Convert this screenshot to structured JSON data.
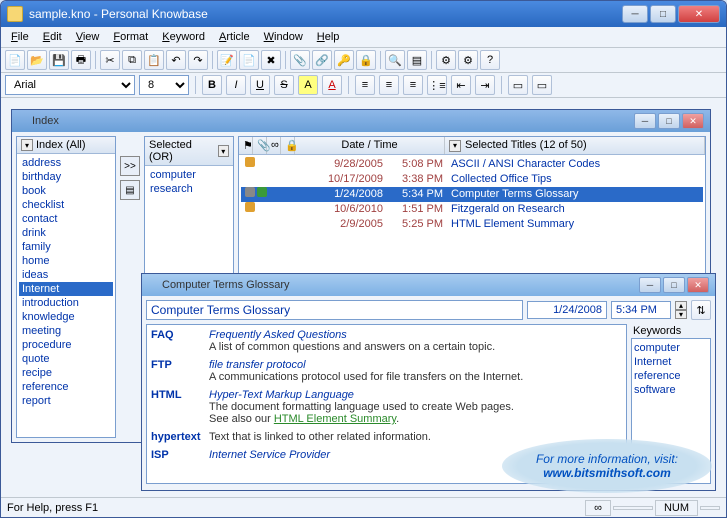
{
  "app": {
    "title": "sample.kno - Personal Knowbase"
  },
  "menu": [
    "File",
    "Edit",
    "View",
    "Format",
    "Keyword",
    "Article",
    "Window",
    "Help"
  ],
  "font": {
    "name": "Arial",
    "size": "8"
  },
  "statusbar": {
    "help": "For Help, press F1",
    "num": "NUM"
  },
  "index": {
    "title": "Index",
    "allLabel": "Index (All)",
    "selectedLabel": "Selected (OR)",
    "items": [
      "address",
      "birthday",
      "book",
      "checklist",
      "contact",
      "drink",
      "family",
      "home",
      "ideas",
      "Internet",
      "introduction",
      "knowledge",
      "meeting",
      "procedure",
      "quote",
      "recipe",
      "reference",
      "report"
    ],
    "selectedIndex": 9,
    "selectedItems": [
      "computer",
      "research"
    ],
    "titlesHeader": {
      "datetime": "Date / Time",
      "titles": "Selected Titles (12 of 50)"
    },
    "rows": [
      {
        "date": "9/28/2005",
        "time": "5:08 PM",
        "name": "ASCII / ANSI Character Codes",
        "icons": [
          "flag"
        ]
      },
      {
        "date": "10/17/2009",
        "time": "3:38 PM",
        "name": "Collected Office Tips",
        "icons": []
      },
      {
        "date": "1/24/2008",
        "time": "5:34 PM",
        "name": "Computer Terms Glossary",
        "icons": [
          "clip",
          "link"
        ],
        "selected": true
      },
      {
        "date": "10/6/2010",
        "time": "1:51 PM",
        "name": "Fitzgerald on Research",
        "icons": [
          "flag"
        ]
      },
      {
        "date": "2/9/2005",
        "time": "5:25 PM",
        "name": "HTML Element Summary",
        "icons": []
      }
    ]
  },
  "article": {
    "windowTitle": "Computer Terms Glossary",
    "title": "Computer Terms Glossary",
    "date": "1/24/2008",
    "time": "5:34 PM",
    "keywordsLabel": "Keywords",
    "keywords": [
      "computer",
      "Internet",
      "reference",
      "software"
    ],
    "terms": [
      {
        "t": "FAQ",
        "ital": "Frequently Asked Questions",
        "def": "A list of common questions and answers on a certain topic."
      },
      {
        "t": "FTP",
        "ital": "file transfer protocol",
        "def": "A communications protocol used for file transfers on the Internet."
      },
      {
        "t": "HTML",
        "ital": "Hyper-Text Markup Language",
        "def": "The document formatting language used to create Web pages.",
        "extra": "See also our ",
        "link": "HTML Element Summary",
        "after": "."
      },
      {
        "t": "hypertext",
        "ital": "",
        "def": "Text that is linked to other related information."
      },
      {
        "t": "ISP",
        "ital": "Internet Service Provider",
        "def": ""
      }
    ]
  },
  "callout": {
    "line1": "For more information, visit:",
    "line2": "www.bitsmithsoft.com"
  }
}
